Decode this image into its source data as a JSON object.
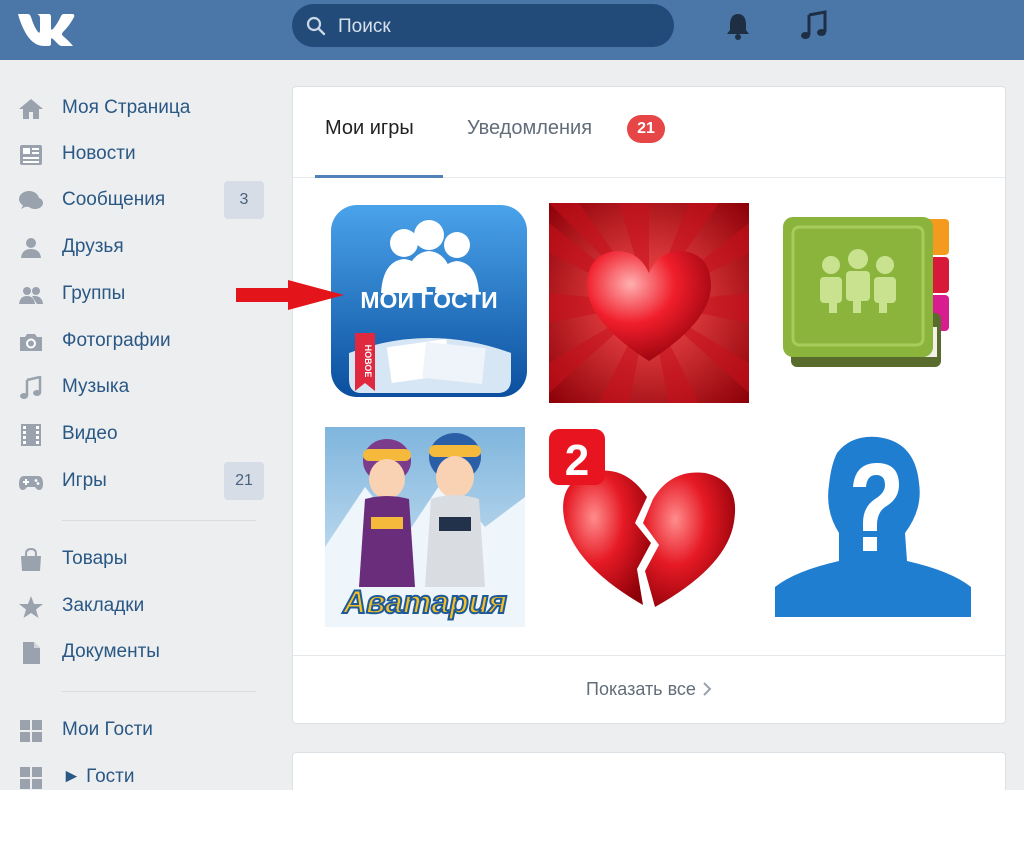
{
  "header": {
    "search_placeholder": "Поиск",
    "brand_color": "#4a76a8"
  },
  "sidebar": {
    "items": [
      {
        "label": "Моя Страница",
        "icon": "home-icon"
      },
      {
        "label": "Новости",
        "icon": "news-icon"
      },
      {
        "label": "Сообщения",
        "icon": "messages-icon",
        "badge": "3"
      },
      {
        "label": "Друзья",
        "icon": "friend-icon"
      },
      {
        "label": "Группы",
        "icon": "groups-icon"
      },
      {
        "label": "Фотографии",
        "icon": "camera-icon"
      },
      {
        "label": "Музыка",
        "icon": "music-note-icon"
      },
      {
        "label": "Видео",
        "icon": "film-icon"
      },
      {
        "label": "Игры",
        "icon": "gamepad-icon",
        "badge": "21"
      },
      {
        "label": "Товары",
        "icon": "shopping-bag-icon"
      },
      {
        "label": "Закладки",
        "icon": "star-icon"
      },
      {
        "label": "Документы",
        "icon": "document-icon"
      },
      {
        "label": "Мои Гости",
        "icon": "app-grid-icon"
      },
      {
        "label": "► Гости",
        "icon": "app-grid-icon"
      }
    ]
  },
  "games": {
    "tabs": {
      "my_games": "Мои игры",
      "notifications": "Уведомления",
      "notifications_count": "21"
    },
    "tiles": [
      {
        "name": "game-tile-moi-gosti",
        "caption": "МОИ ГОСТИ",
        "ribbon": "НОВОЕ"
      },
      {
        "name": "game-tile-heart"
      },
      {
        "name": "game-tile-green-book"
      },
      {
        "name": "game-tile-avatariya",
        "caption": "Аватария"
      },
      {
        "name": "game-tile-broken-heart",
        "badge": "2"
      },
      {
        "name": "game-tile-mystery-person"
      }
    ],
    "show_all": "Показать все"
  }
}
